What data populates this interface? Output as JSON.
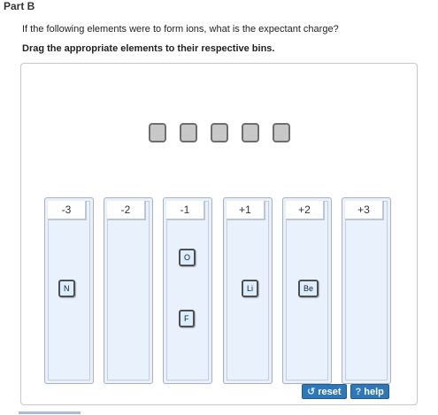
{
  "part_title": "Part B",
  "question": "If the following elements were to form ions, what is the expectant charge?",
  "instruction": "Drag the appropriate elements to their respective bins.",
  "placeholders": 5,
  "bins": [
    {
      "label": "-3",
      "chips": [
        "N"
      ]
    },
    {
      "label": "-2",
      "chips": []
    },
    {
      "label": "-1",
      "chips": [
        "O",
        "F"
      ]
    },
    {
      "label": "+1",
      "chips": [
        "Li"
      ]
    },
    {
      "label": "+2",
      "chips": [
        "Be"
      ]
    },
    {
      "label": "+3",
      "chips": []
    }
  ],
  "buttons": {
    "reset_label": "reset",
    "reset_icon": "reset-icon",
    "help_label": "help",
    "help_icon": "help-icon"
  },
  "colors": {
    "bin_bg": "#e8f0fc",
    "button_bg": "#2f78b8",
    "chip_bg": "#dbeeff"
  }
}
